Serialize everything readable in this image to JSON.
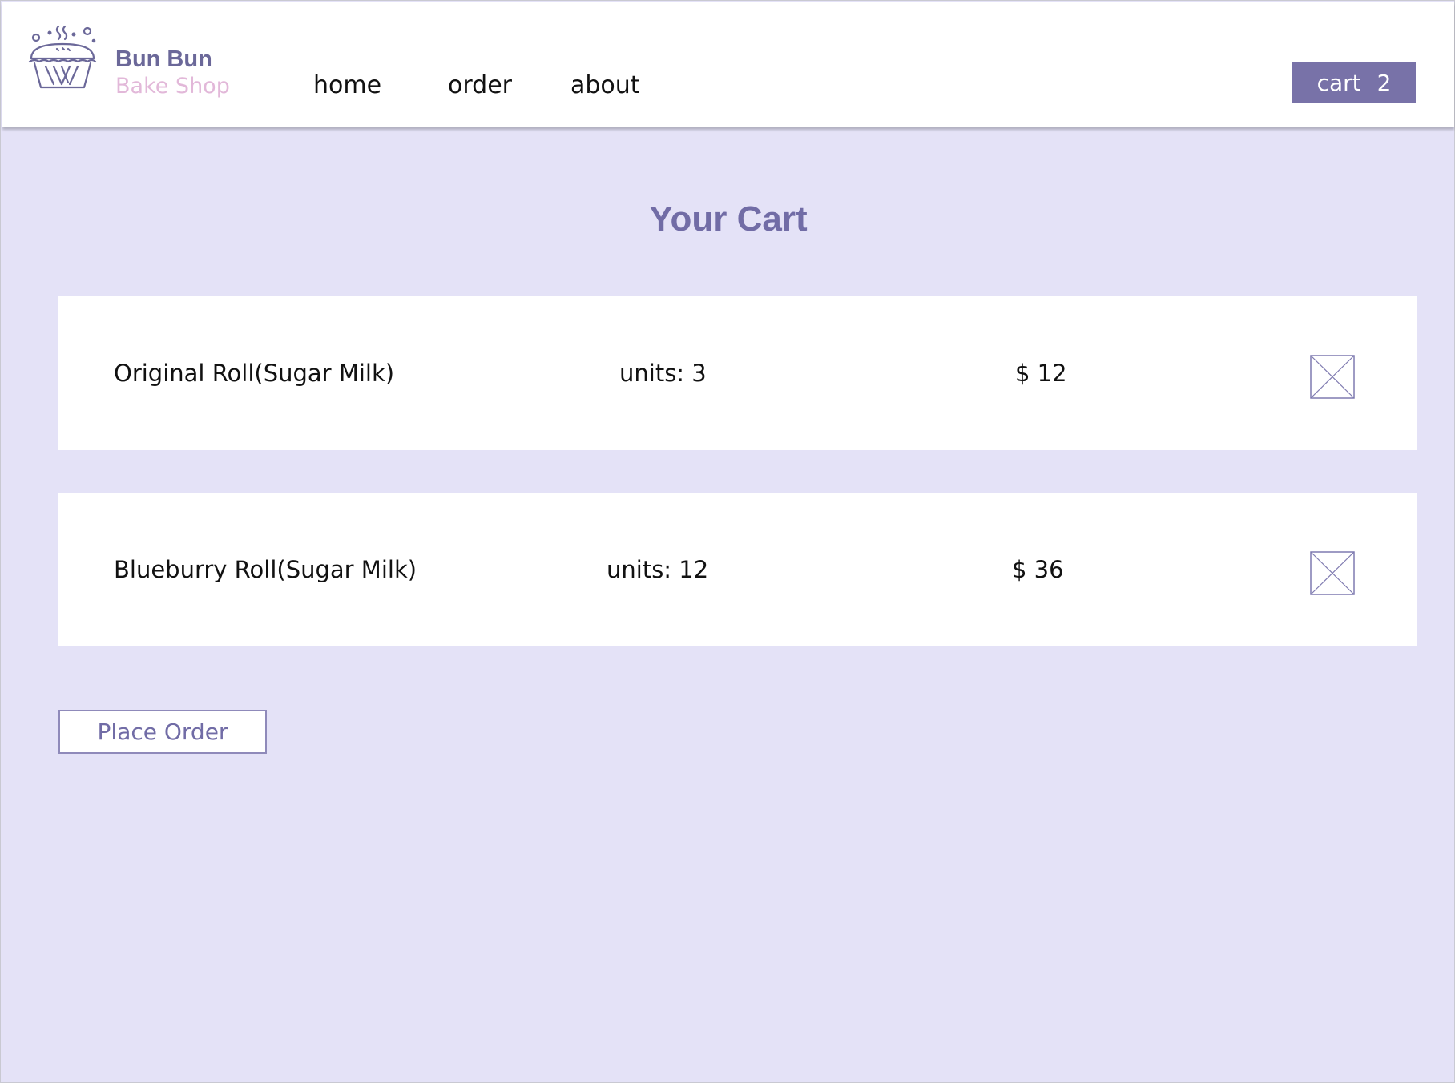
{
  "brand": {
    "line1": "Bun Bun",
    "line2": "Bake Shop",
    "logo_icon": "pie-basket-icon"
  },
  "nav": {
    "items": [
      {
        "label": "home"
      },
      {
        "label": "order"
      },
      {
        "label": "about"
      }
    ]
  },
  "cart_button": {
    "label": "cart",
    "count": "2"
  },
  "page": {
    "title": "Your Cart"
  },
  "cart_items": [
    {
      "name": "Original Roll(Sugar Milk)",
      "units": "units: 3",
      "price": "$ 12",
      "remove_icon": "remove-x-icon"
    },
    {
      "name": "Blueburry Roll(Sugar Milk)",
      "units": "units: 12",
      "price": "$ 36",
      "remove_icon": "remove-x-icon"
    }
  ],
  "actions": {
    "place_order_label": "Place Order"
  },
  "colors": {
    "page_background": "#e4e2f7",
    "accent_purple": "#7872a8",
    "title_purple": "#716ca6",
    "brand_pink": "#e2b8d9"
  }
}
